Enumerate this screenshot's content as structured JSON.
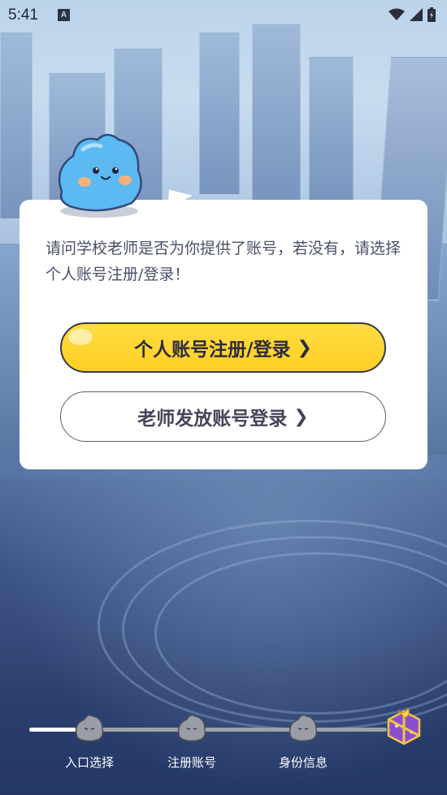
{
  "status_bar": {
    "time": "5:41",
    "notification_icon": "A"
  },
  "dialog": {
    "prompt": "请问学校老师是否为你提供了账号，若没有，请选择个人账号注册/登录！",
    "primary_button": "个人账号注册/登录",
    "secondary_button": "老师发放账号登录",
    "chevron": "❯"
  },
  "progress": {
    "current_step": 1,
    "fill_fraction": 0.13,
    "steps": [
      {
        "label": "入口选择"
      },
      {
        "label": "注册账号"
      },
      {
        "label": "身份信息"
      }
    ],
    "reward_icon": "gift-box-icon"
  },
  "colors": {
    "primary_button": "#ffd430",
    "dialog_bg": "#ffffff",
    "prompt_text": "#4b4f6a",
    "mascot": "#5bb8f0"
  }
}
